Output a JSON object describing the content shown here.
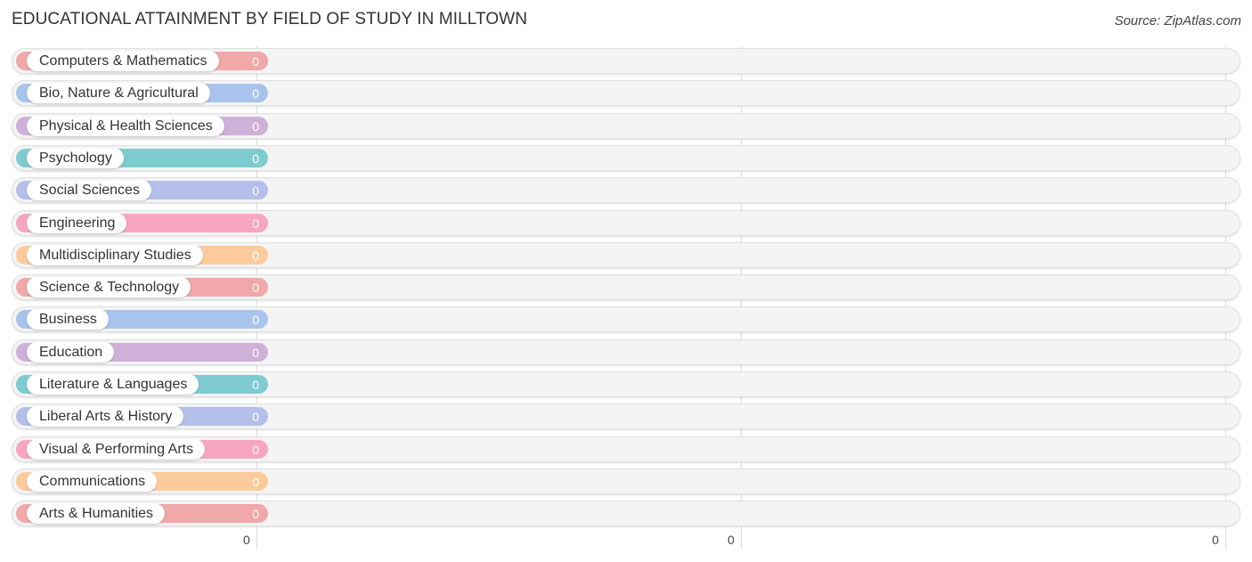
{
  "title": "EDUCATIONAL ATTAINMENT BY FIELD OF STUDY IN MILLTOWN",
  "source": "Source: ZipAtlas.com",
  "chart_data": {
    "type": "bar",
    "orientation": "horizontal",
    "title": "EDUCATIONAL ATTAINMENT BY FIELD OF STUDY IN MILLTOWN",
    "categories": [
      "Computers & Mathematics",
      "Bio, Nature & Agricultural",
      "Physical & Health Sciences",
      "Psychology",
      "Social Sciences",
      "Engineering",
      "Multidisciplinary Studies",
      "Science & Technology",
      "Business",
      "Education",
      "Literature & Languages",
      "Liberal Arts & History",
      "Visual & Performing Arts",
      "Communications",
      "Arts & Humanities"
    ],
    "values": [
      0,
      0,
      0,
      0,
      0,
      0,
      0,
      0,
      0,
      0,
      0,
      0,
      0,
      0,
      0
    ],
    "value_labels": [
      "0",
      "0",
      "0",
      "0",
      "0",
      "0",
      "0",
      "0",
      "0",
      "0",
      "0",
      "0",
      "0",
      "0",
      "0"
    ],
    "colors": [
      "#f0a8a8",
      "#a8c4ec",
      "#cfb0d8",
      "#7ecbd0",
      "#b4bfea",
      "#f7a6c0",
      "#fccb9c",
      "#f0a8a8",
      "#a8c4ec",
      "#cfb0d8",
      "#7ecbd0",
      "#b4bfea",
      "#f7a6c0",
      "#fccb9c",
      "#f0a8a8"
    ],
    "x_tick_labels": [
      "0",
      "0",
      "0"
    ],
    "xlabel": "",
    "ylabel": "",
    "grid": true,
    "legend": "none"
  }
}
